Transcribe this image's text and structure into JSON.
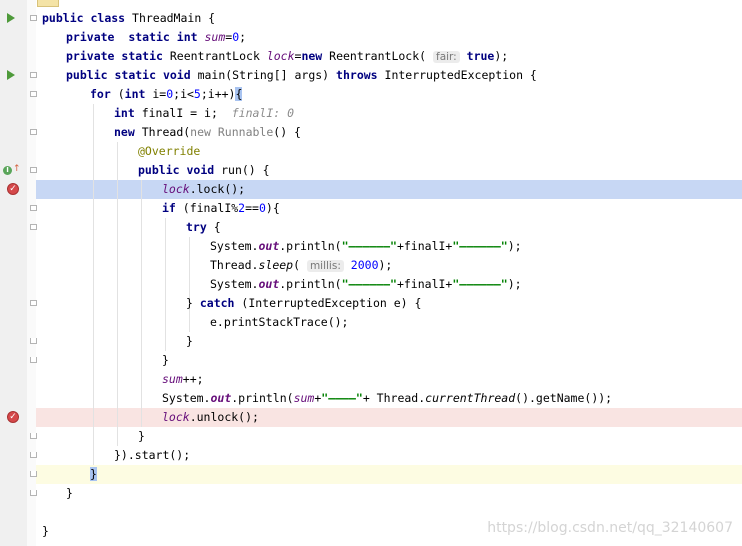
{
  "editor": {
    "language": "java",
    "current_line": "lock.lock();",
    "lines": [
      {
        "indent": 0,
        "tokens": [
          {
            "t": "public ",
            "c": "kw"
          },
          {
            "t": "class ",
            "c": "kw"
          },
          {
            "t": "ThreadMain {"
          }
        ]
      },
      {
        "indent": 1,
        "tokens": [
          {
            "t": "private  ",
            "c": "kw"
          },
          {
            "t": "static ",
            "c": "kw"
          },
          {
            "t": "int ",
            "c": "kw"
          },
          {
            "t": "sum",
            "c": "field"
          },
          {
            "t": "="
          },
          {
            "t": "0",
            "c": "num"
          },
          {
            "t": ";"
          }
        ]
      },
      {
        "indent": 1,
        "tokens": [
          {
            "t": "private ",
            "c": "kw"
          },
          {
            "t": "static ",
            "c": "kw"
          },
          {
            "t": "ReentrantLock "
          },
          {
            "t": "lock",
            "c": "field"
          },
          {
            "t": "="
          },
          {
            "t": "new ",
            "c": "kw"
          },
          {
            "t": "ReentrantLock( "
          },
          {
            "t": "fair:",
            "c": "hint"
          },
          {
            "t": " "
          },
          {
            "t": "true",
            "c": "kw"
          },
          {
            "t": ");"
          }
        ]
      },
      {
        "indent": 1,
        "tokens": [
          {
            "t": "public ",
            "c": "kw"
          },
          {
            "t": "static ",
            "c": "kw"
          },
          {
            "t": "void ",
            "c": "kw"
          },
          {
            "t": "main(String[] args) "
          },
          {
            "t": "throws ",
            "c": "kw"
          },
          {
            "t": "InterruptedException {"
          }
        ]
      },
      {
        "indent": 2,
        "tokens": [
          {
            "t": "for ",
            "c": "kw"
          },
          {
            "t": "("
          },
          {
            "t": "int ",
            "c": "kw"
          },
          {
            "t": "i="
          },
          {
            "t": "0",
            "c": "num"
          },
          {
            "t": ";i<"
          },
          {
            "t": "5",
            "c": "num"
          },
          {
            "t": ";i++)"
          },
          {
            "t": "{",
            "c": "brace-hl"
          }
        ]
      },
      {
        "indent": 3,
        "tokens": [
          {
            "t": "int ",
            "c": "kw"
          },
          {
            "t": "finalI = i;  "
          },
          {
            "t": "finalI: 0",
            "c": "inlay"
          }
        ]
      },
      {
        "indent": 3,
        "tokens": [
          {
            "t": "new ",
            "c": "kw"
          },
          {
            "t": "Thread("
          },
          {
            "t": "new ",
            "c": "gray"
          },
          {
            "t": "Runnable",
            "c": "gray"
          },
          {
            "t": "() {"
          }
        ]
      },
      {
        "indent": 4,
        "tokens": [
          {
            "t": "@Override",
            "c": "ann"
          }
        ]
      },
      {
        "indent": 4,
        "tokens": [
          {
            "t": "public ",
            "c": "kw"
          },
          {
            "t": "void ",
            "c": "kw"
          },
          {
            "t": "run() {"
          }
        ]
      },
      {
        "indent": 5,
        "tokens": [
          {
            "t": "lock",
            "c": "field"
          },
          {
            "t": ".lock();"
          }
        ]
      },
      {
        "indent": 5,
        "tokens": [
          {
            "t": "if ",
            "c": "kw"
          },
          {
            "t": "(finalI%"
          },
          {
            "t": "2",
            "c": "num"
          },
          {
            "t": "=="
          },
          {
            "t": "0",
            "c": "num"
          },
          {
            "t": "){"
          }
        ]
      },
      {
        "indent": 6,
        "tokens": [
          {
            "t": "try ",
            "c": "kw"
          },
          {
            "t": "{"
          }
        ]
      },
      {
        "indent": 7,
        "tokens": [
          {
            "t": "System."
          },
          {
            "t": "out",
            "c": "sfield"
          },
          {
            "t": ".println("
          },
          {
            "t": "\"——————\"",
            "c": "str"
          },
          {
            "t": "+finalI+"
          },
          {
            "t": "\"——————\"",
            "c": "str"
          },
          {
            "t": ");"
          }
        ]
      },
      {
        "indent": 7,
        "tokens": [
          {
            "t": "Thread."
          },
          {
            "t": "sleep",
            "c": "smethod"
          },
          {
            "t": "( "
          },
          {
            "t": "millis:",
            "c": "hint"
          },
          {
            "t": " "
          },
          {
            "t": "2000",
            "c": "num"
          },
          {
            "t": ");"
          }
        ]
      },
      {
        "indent": 7,
        "tokens": [
          {
            "t": "System."
          },
          {
            "t": "out",
            "c": "sfield"
          },
          {
            "t": ".println("
          },
          {
            "t": "\"——————\"",
            "c": "str"
          },
          {
            "t": "+finalI+"
          },
          {
            "t": "\"——————\"",
            "c": "str"
          },
          {
            "t": ");"
          }
        ]
      },
      {
        "indent": 6,
        "tokens": [
          {
            "t": "} "
          },
          {
            "t": "catch ",
            "c": "kw"
          },
          {
            "t": "(InterruptedException e) {"
          }
        ]
      },
      {
        "indent": 7,
        "tokens": [
          {
            "t": "e.printStackTrace();"
          }
        ]
      },
      {
        "indent": 6,
        "tokens": [
          {
            "t": "}"
          }
        ]
      },
      {
        "indent": 5,
        "tokens": [
          {
            "t": "}"
          }
        ]
      },
      {
        "indent": 5,
        "tokens": [
          {
            "t": "sum",
            "c": "field"
          },
          {
            "t": "++;"
          }
        ]
      },
      {
        "indent": 5,
        "tokens": [
          {
            "t": "System."
          },
          {
            "t": "out",
            "c": "sfield"
          },
          {
            "t": ".println("
          },
          {
            "t": "sum",
            "c": "field"
          },
          {
            "t": "+"
          },
          {
            "t": "\"————\"",
            "c": "str"
          },
          {
            "t": "+ Thread."
          },
          {
            "t": "currentThread",
            "c": "smethod"
          },
          {
            "t": "().getName());"
          }
        ]
      },
      {
        "indent": 5,
        "tokens": [
          {
            "t": "lock",
            "c": "field"
          },
          {
            "t": ".unlock();"
          }
        ]
      },
      {
        "indent": 4,
        "tokens": [
          {
            "t": "}"
          }
        ]
      },
      {
        "indent": 3,
        "tokens": [
          {
            "t": "}).start();"
          }
        ]
      },
      {
        "indent": 2,
        "tokens": [
          {
            "t": "}",
            "c": "brace-hl"
          }
        ]
      },
      {
        "indent": 1,
        "tokens": [
          {
            "t": "}"
          }
        ]
      },
      {
        "indent": 0,
        "tokens": [
          {
            "t": ""
          }
        ]
      },
      {
        "indent": 0,
        "tokens": [
          {
            "t": "}"
          }
        ]
      }
    ],
    "gutter_icons": [
      {
        "line": 0,
        "icon": "run-icon"
      },
      {
        "line": 3,
        "icon": "run-icon"
      },
      {
        "line": 8,
        "icon": "implements-method-icon",
        "glyph": "I",
        "arrow": "↑"
      },
      {
        "line": 9,
        "icon": "breakpoint-icon",
        "glyph": "✓"
      },
      {
        "line": 21,
        "icon": "breakpoint-icon",
        "glyph": "✓"
      }
    ],
    "line_highlights": [
      {
        "line": 9,
        "kind": "current"
      },
      {
        "line": 21,
        "kind": "bp"
      },
      {
        "line": 24,
        "kind": "caret"
      }
    ]
  },
  "watermark": "https://blog.csdn.net/qq_32140607"
}
